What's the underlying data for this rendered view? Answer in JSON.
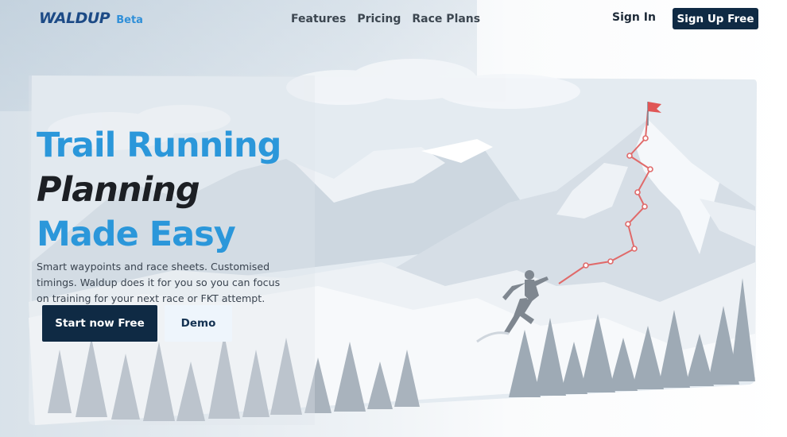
{
  "brand": {
    "name": "WALDUP",
    "badge": "Beta"
  },
  "nav": {
    "links": [
      "Features",
      "Pricing",
      "Race Plans"
    ],
    "sign_in": "Sign In",
    "sign_up": "Sign Up Free"
  },
  "hero": {
    "line1": "Trail Running",
    "line2": "Planning",
    "line3": "Made Easy",
    "description": "Smart waypoints and race sheets. Customised timings. Waldup does it for you so you can focus on training for your next race or FKT attempt.",
    "primary_cta": "Start now Free",
    "secondary_cta": "Demo"
  },
  "colors": {
    "brand_blue": "#2b97da",
    "navy": "#0f2a44",
    "route_red": "#e06a6a"
  }
}
